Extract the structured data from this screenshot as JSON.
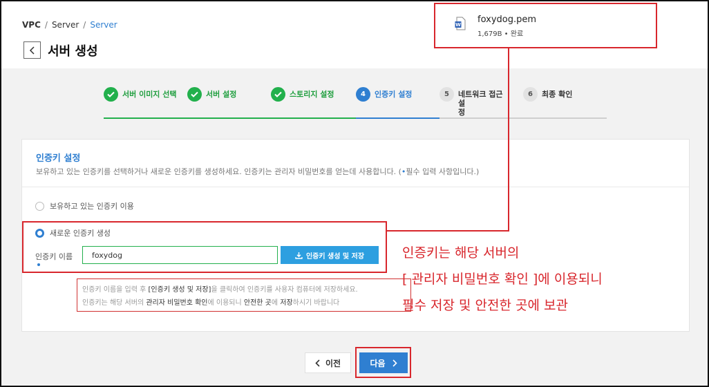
{
  "breadcrumb": [
    "VPC",
    "Server",
    "Server"
  ],
  "page_title": "서버 생성",
  "steps": [
    {
      "num": "1",
      "label": "서버 이미지 선택",
      "state": "done"
    },
    {
      "num": "2",
      "label": "서버 설정",
      "state": "done"
    },
    {
      "num": "3",
      "label": "스토리지 설정",
      "state": "done"
    },
    {
      "num": "4",
      "label": "인증키 설정",
      "state": "active"
    },
    {
      "num": "5",
      "label": "네트워크 접근 설\n정",
      "state": "todo"
    },
    {
      "num": "6",
      "label": "최종 확인",
      "state": "todo"
    }
  ],
  "section": {
    "title": "인증키 설정",
    "desc_prefix": "보유하고 있는 인증키를 선택하거나 새로운 인증키를 생성하세요. 인증키는 관리자 비밀번호를 얻는데 사용합니다. (",
    "desc_dot": "•",
    "desc_suffix": "필수 입력 사항입니다.)"
  },
  "radio_existing": {
    "label": "보유하고 있는 인증키 이용",
    "checked": false
  },
  "radio_new": {
    "label": "새로운 인증키 생성",
    "checked": true
  },
  "key_name": {
    "label": "인증키 이름",
    "value": "foxydog"
  },
  "create_button": "인증키 생성 및 저장",
  "note": {
    "l1_a": "인증키 이름을 입력 후 ",
    "l1_b": "[인증키 생성 및 저장]",
    "l1_c": "을 클릭하여 인증키를 사용자 컴퓨터에 저장하세요.",
    "l2_a": "인증키는 해당 서버의 ",
    "l2_b": "관리자 비밀번호 확인",
    "l2_c": "에 이용되니 ",
    "l2_d": "안전한 곳",
    "l2_e": "에 ",
    "l2_f": "저장",
    "l2_g": "하시기 바랍니다"
  },
  "download": {
    "file_name": "foxydog.pem",
    "meta": "1,679B • 완료",
    "icon": "word-document-icon"
  },
  "annotation": [
    "인증키는 해당 서버의",
    "[ 관리자 비밀번호 확인 ]에 이용되니",
    "필수 저장 및 안전한 곳에 보관"
  ],
  "prev_button": "이전",
  "next_button": "다음",
  "colors": {
    "green": "#22b04c",
    "blue": "#2f7fd1",
    "red": "#d8262c",
    "button_blue": "#2d9fe0"
  }
}
